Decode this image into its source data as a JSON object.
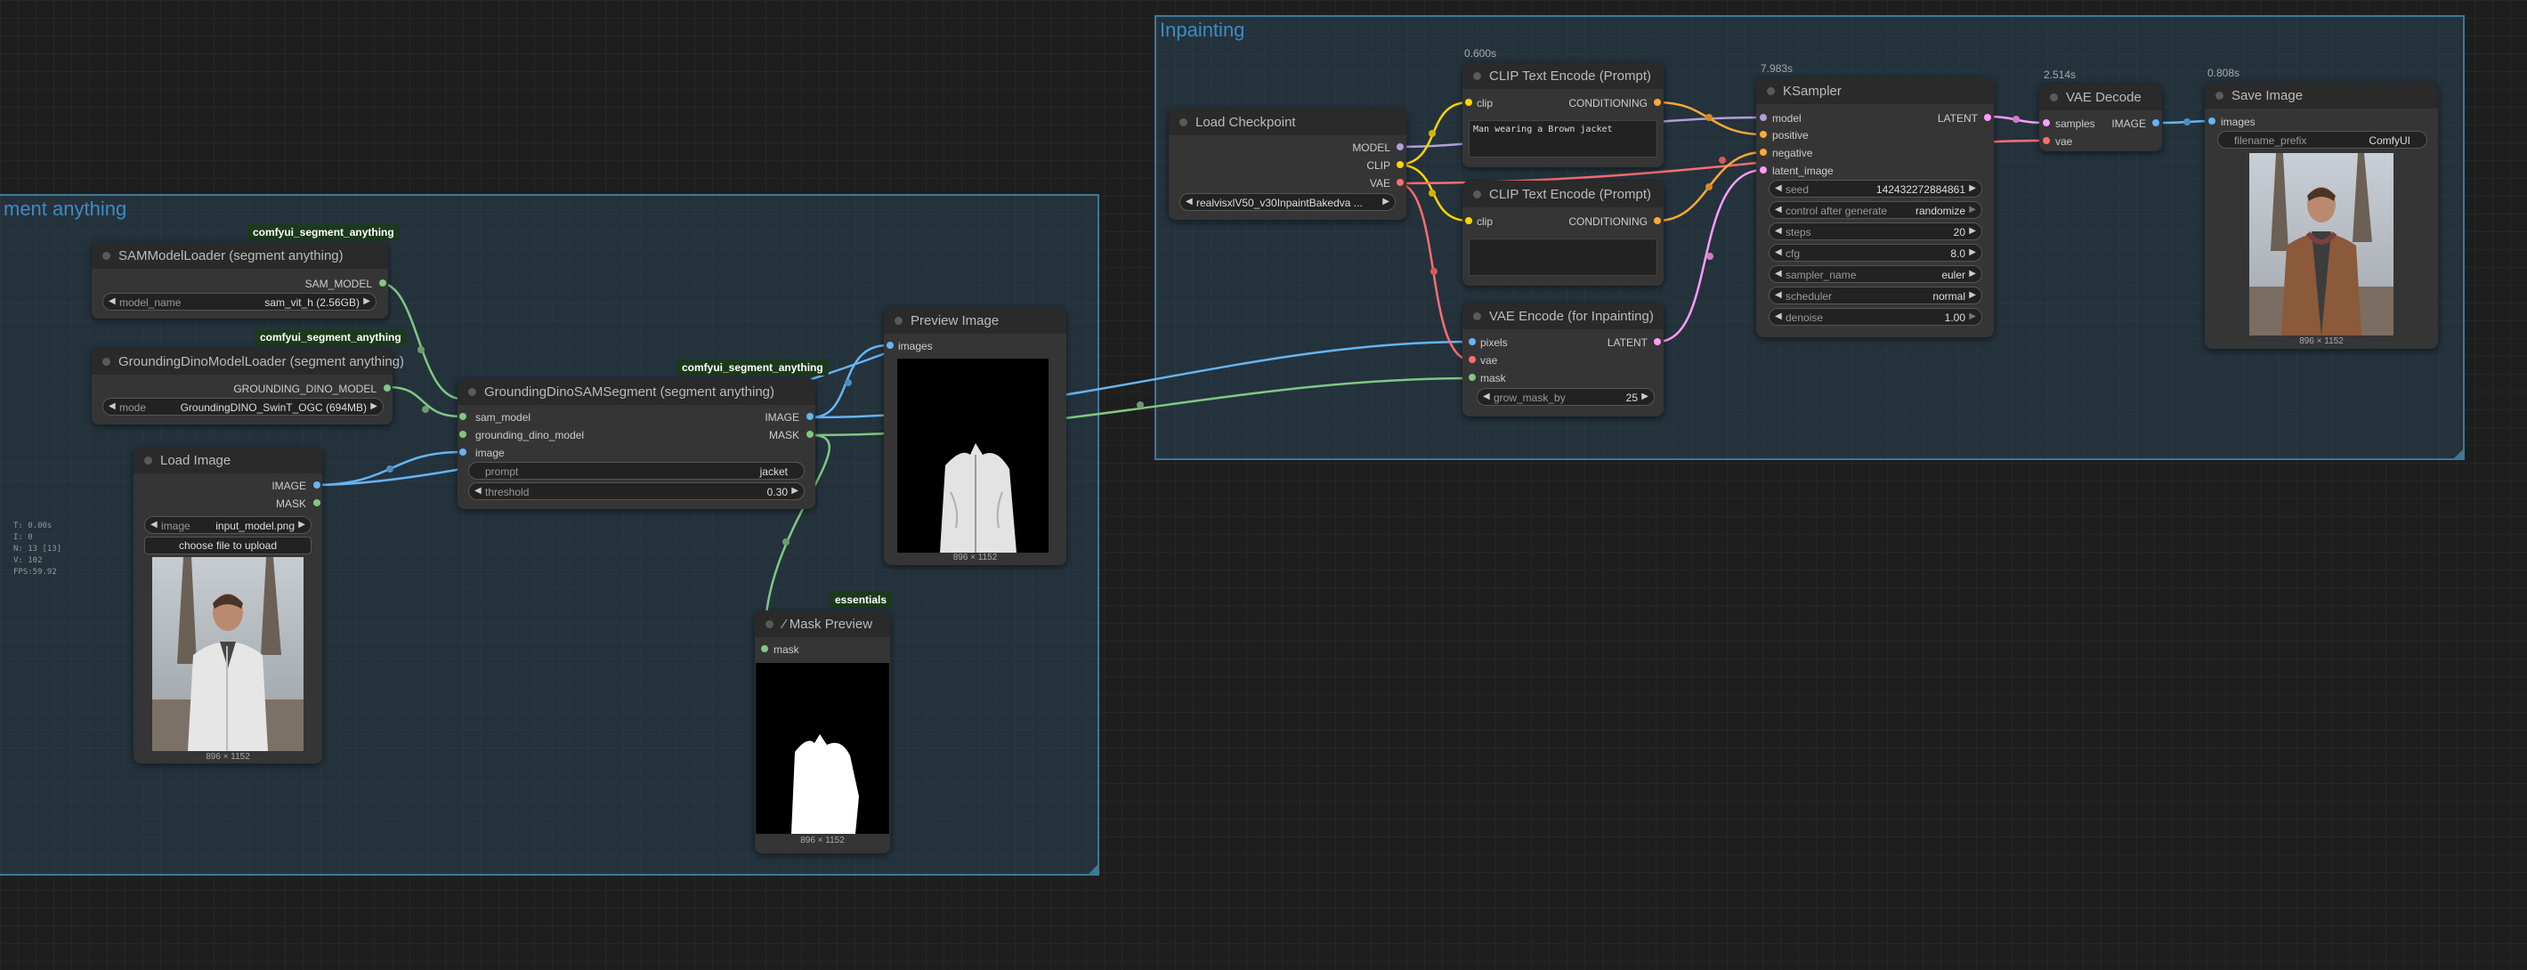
{
  "groups": {
    "segment": {
      "title": "ment anything"
    },
    "inpainting": {
      "title": "Inpainting"
    }
  },
  "colors": {
    "image_link": "#64b5f6",
    "mask_link": "#81c784",
    "model_link": "#b39ddb",
    "clip_link": "#ffd500",
    "vae_link": "#ff6e6e",
    "conditioning_link": "#ffa931",
    "latent_link": "#ff9cf9"
  },
  "stats": {
    "lines": [
      "T: 0.00s",
      "I: 0",
      "N: 13 [13]",
      "V: 102",
      "FPS:59.92"
    ]
  },
  "nodes": {
    "sam_loader": {
      "title": "SAMModelLoader (segment anything)",
      "badge": "comfyui_segment_anything",
      "output_sam_model": "SAM_MODEL",
      "model_name_label": "model_name",
      "model_name_value": "sam_vit_h (2.56GB)"
    },
    "dino_loader": {
      "title": "GroundingDinoModelLoader (segment anything)",
      "badge": "comfyui_segment_anything",
      "output_dino_model": "GROUNDING_DINO_MODEL",
      "mode_label": "mode",
      "mode_value": "GroundingDINO_SwinT_OGC (694MB)"
    },
    "load_image": {
      "title": "Load Image",
      "output_image": "IMAGE",
      "output_mask": "MASK",
      "image_label": "image",
      "image_value": "input_model.png",
      "upload_label": "choose file to upload",
      "dims": "896 × 1152"
    },
    "dino_sam_segment": {
      "title": "GroundingDinoSAMSegment (segment anything)",
      "badge": "comfyui_segment_anything",
      "input_sam_model": "sam_model",
      "input_dino_model": "grounding_dino_model",
      "input_image": "image",
      "output_image": "IMAGE",
      "output_mask": "MASK",
      "prompt_label": "prompt",
      "prompt_value": "jacket",
      "threshold_label": "threshold",
      "threshold_value": "0.30"
    },
    "preview_image": {
      "title": "Preview Image",
      "input_images": "images",
      "dims": "896 × 1152"
    },
    "mask_preview": {
      "title": "Mask Preview",
      "badge": "essentials",
      "input_mask": "mask",
      "dims": "896 × 1152"
    },
    "load_checkpoint": {
      "title": "Load Checkpoint",
      "output_model": "MODEL",
      "output_clip": "CLIP",
      "output_vae": "VAE",
      "ckpt_value": "realvisxlV50_v30InpaintBakedva ..."
    },
    "clip_pos": {
      "title": "CLIP Text Encode (Prompt)",
      "timing": "0.600s",
      "input_clip": "clip",
      "output_conditioning": "CONDITIONING",
      "text": "Man wearing a Brown jacket"
    },
    "clip_neg": {
      "title": "CLIP Text Encode (Prompt)",
      "input_clip": "clip",
      "output_conditioning": "CONDITIONING",
      "text": ""
    },
    "vae_encode_inpaint": {
      "title": "VAE Encode (for Inpainting)",
      "input_pixels": "pixels",
      "input_vae": "vae",
      "input_mask": "mask",
      "output_latent": "LATENT",
      "grow_label": "grow_mask_by",
      "grow_value": "25"
    },
    "ksampler": {
      "title": "KSampler",
      "timing": "7.983s",
      "input_model": "model",
      "input_positive": "positive",
      "input_negative": "negative",
      "input_latent": "latent_image",
      "output_latent": "LATENT",
      "widgets": [
        {
          "label": "seed",
          "value": "142432272884861"
        },
        {
          "label": "control after generate",
          "value": "randomize"
        },
        {
          "label": "steps",
          "value": "20"
        },
        {
          "label": "cfg",
          "value": "8.0"
        },
        {
          "label": "sampler_name",
          "value": "euler"
        },
        {
          "label": "scheduler",
          "value": "normal"
        },
        {
          "label": "denoise",
          "value": "1.00"
        }
      ]
    },
    "vae_decode": {
      "title": "VAE Decode",
      "timing": "2.514s",
      "input_samples": "samples",
      "input_vae": "vae",
      "output_image": "IMAGE"
    },
    "save_image": {
      "title": "Save Image",
      "timing": "0.808s",
      "input_images": "images",
      "prefix_label": "filename_prefix",
      "prefix_value": "ComfyUI",
      "dims": "896 × 1152"
    }
  }
}
